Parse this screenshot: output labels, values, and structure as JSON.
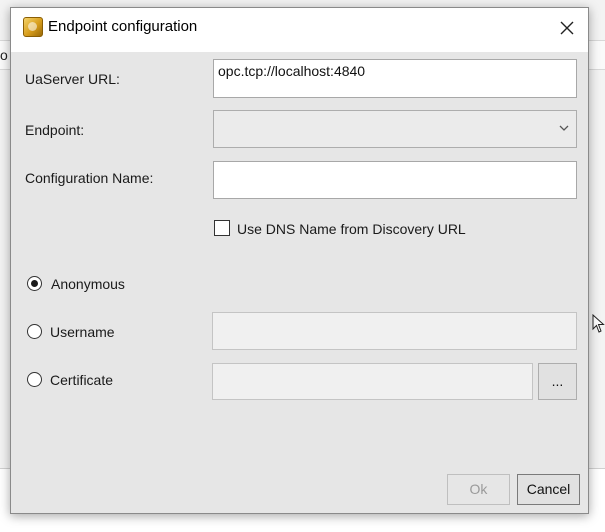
{
  "background": {
    "fragment": "o"
  },
  "dialog": {
    "title": "Endpoint configuration",
    "icon": "app-icon",
    "close_icon": "close-icon",
    "fields": {
      "uaserver_url_label": "UaServer URL:",
      "uaserver_url_value": "opc.tcp://localhost:4840",
      "endpoint_label": "Endpoint:",
      "endpoint_value": "",
      "configuration_name_label": "Configuration Name:",
      "configuration_name_value": ""
    },
    "use_dns_checkbox": {
      "label": "Use DNS Name from Discovery URL",
      "checked": false
    },
    "auth": {
      "anonymous": {
        "label": "Anonymous",
        "checked": true
      },
      "username": {
        "label": "Username",
        "checked": false,
        "value": ""
      },
      "certificate": {
        "label": "Certificate",
        "checked": false,
        "value": "",
        "browse_label": "..."
      }
    },
    "buttons": {
      "ok": "Ok",
      "cancel": "Cancel"
    }
  }
}
